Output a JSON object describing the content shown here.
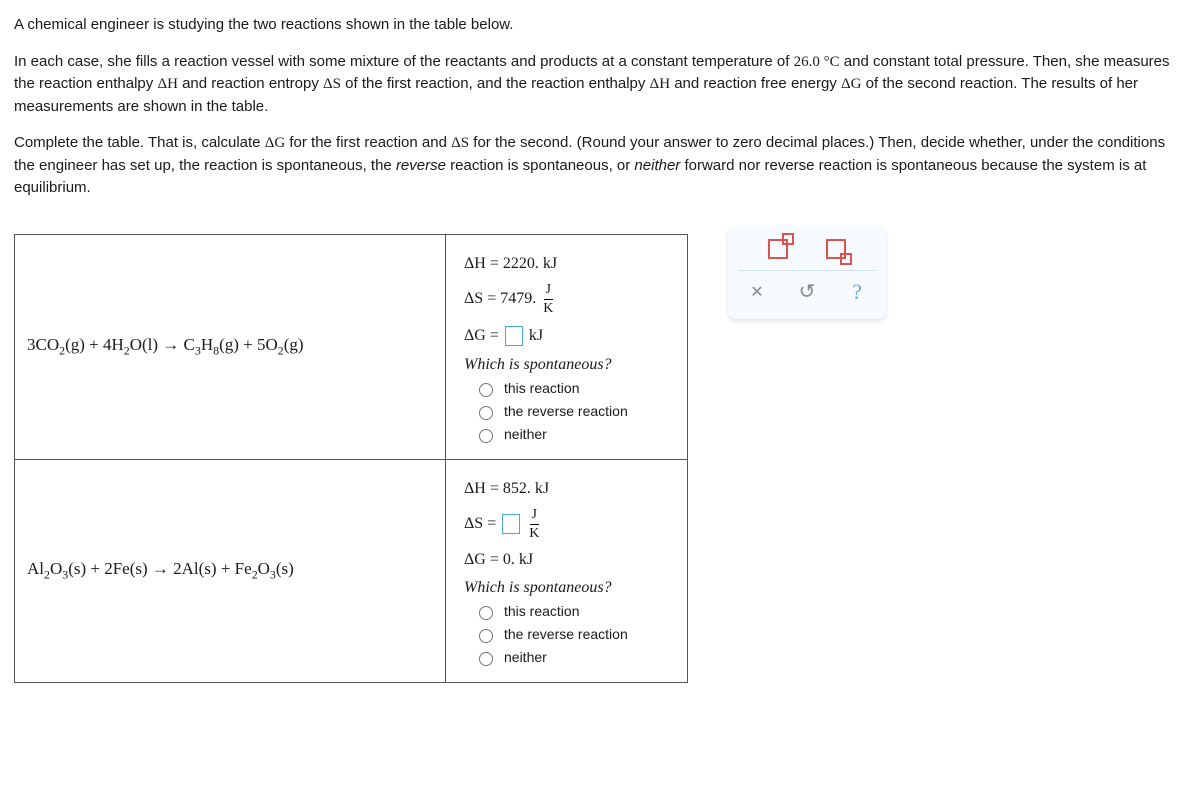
{
  "intro": {
    "p1": "A chemical engineer is studying the two reactions shown in the table below.",
    "p2_a": "In each case, she fills a reaction vessel with some mixture of the reactants and products at a constant temperature of ",
    "temp": "26.0 °C",
    "p2_b": " and constant total pressure. Then, she measures the reaction enthalpy ",
    "dH": "ΔH",
    "p2_c": " and reaction entropy ",
    "dS": "ΔS",
    "p2_d": " of the first reaction, and the reaction enthalpy ",
    "p2_e": " and reaction free energy ",
    "dG": "ΔG",
    "p2_f": " of the second reaction. The results of her measurements are shown in the table.",
    "p3_a": "Complete the table. That is, calculate ",
    "p3_b": " for the first reaction and ",
    "p3_c": " for the second. (Round your answer to zero decimal places.) Then, decide whether, under the conditions the engineer has set up, the reaction is spontaneous, the ",
    "rev": "reverse",
    "p3_d": " reaction is spontaneous, or ",
    "nei": "neither",
    "p3_e": " forward nor reverse reaction is spontaneous because the system is at equilibrium."
  },
  "rxn1": {
    "equation_html": "3CO<sub>2</sub>(g) + 4H<sub>2</sub>O(l) → C<sub>3</sub>H<sub>8</sub>(g) + 5O<sub>2</sub>(g)",
    "dH_label": "ΔH",
    "dH_val": "2220. kJ",
    "dS_label": "ΔS",
    "dS_val": "7479.",
    "frac_num": "J",
    "frac_den": "K",
    "dG_label": "ΔG",
    "dG_unit": "kJ",
    "spon_q": "Which is spontaneous?",
    "opt1": "this reaction",
    "opt2": "the reverse reaction",
    "opt3": "neither"
  },
  "rxn2": {
    "equation_html": "Al<sub>2</sub>O<sub>3</sub>(s) + 2Fe(s) → 2Al(s) + Fe<sub>2</sub>O<sub>3</sub>(s)",
    "dH_label": "ΔH",
    "dH_val": "852. kJ",
    "dS_label": "ΔS",
    "frac_num": "J",
    "frac_den": "K",
    "dG_label": "ΔG",
    "dG_val": "0. kJ",
    "spon_q": "Which is spontaneous?",
    "opt1": "this reaction",
    "opt2": "the reverse reaction",
    "opt3": "neither"
  },
  "toolpad": {
    "close": "✕",
    "undo": "↺",
    "help": "?"
  },
  "eq_sign": " = "
}
